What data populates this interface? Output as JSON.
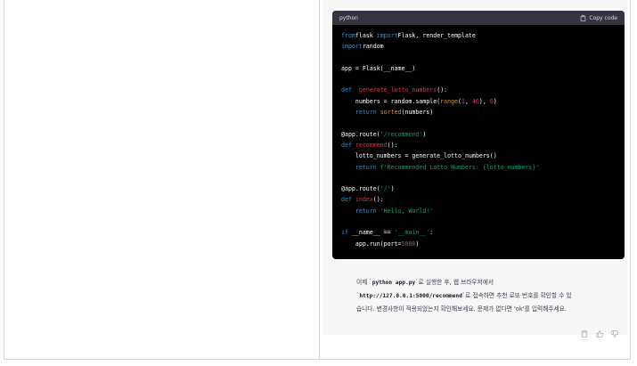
{
  "code_block": {
    "language": "python",
    "copy_label": "Copy code",
    "lines": [
      [
        [
          "kw",
          "from"
        ],
        [
          "",
          "flask "
        ],
        [
          "kw",
          "import"
        ],
        [
          "",
          "Flask, render_template"
        ]
      ],
      [
        [
          "kw",
          "import"
        ],
        [
          "",
          "random"
        ]
      ],
      [],
      [
        [
          "",
          "app = Flask(__name__)"
        ]
      ],
      [],
      [
        [
          "kw",
          "def"
        ],
        [
          "",
          "  "
        ],
        [
          "fn",
          "generate_lotto_numbers"
        ],
        [
          "",
          "():"
        ]
      ],
      [
        [
          "",
          "    numbers = random.sample("
        ],
        [
          "bi",
          "range"
        ],
        [
          "",
          "("
        ],
        [
          "num",
          "1"
        ],
        [
          "",
          ", "
        ],
        [
          "num",
          "46"
        ],
        [
          "",
          "), "
        ],
        [
          "num",
          "6"
        ],
        [
          "",
          ")"
        ]
      ],
      [
        [
          "",
          "    "
        ],
        [
          "kw",
          "return"
        ],
        [
          "",
          ""
        ],
        [
          "bi",
          "sorted"
        ],
        [
          "",
          "(numbers)"
        ]
      ],
      [],
      [
        [
          "",
          "@app.route("
        ],
        [
          "str",
          "'/recommend'"
        ],
        [
          "",
          ")"
        ]
      ],
      [
        [
          "kw",
          "def"
        ],
        [
          "",
          ""
        ],
        [
          "fn",
          "recommend"
        ],
        [
          "",
          "():"
        ]
      ],
      [
        [
          "",
          "    lotto_numbers = generate_lotto_numbers()"
        ]
      ],
      [
        [
          "",
          "    "
        ],
        [
          "kw",
          "return"
        ],
        [
          "",
          ""
        ],
        [
          "str",
          "f'Recommended Lotto Numbers: {lotto_numbers}'"
        ]
      ],
      [],
      [
        [
          "",
          "@app.route("
        ],
        [
          "str",
          "'/'"
        ],
        [
          "",
          ")"
        ]
      ],
      [
        [
          "kw",
          "def"
        ],
        [
          "",
          ""
        ],
        [
          "fn",
          "index"
        ],
        [
          "",
          "():"
        ]
      ],
      [
        [
          "",
          "    "
        ],
        [
          "kw",
          "return"
        ],
        [
          "",
          ""
        ],
        [
          "str",
          "'Hello, World!'"
        ]
      ],
      [],
      [
        [
          "kw",
          "if"
        ],
        [
          "",
          " __name__ == "
        ],
        [
          "str",
          "'__main__'"
        ],
        [
          "",
          ":"
        ]
      ],
      [
        [
          "",
          "    app.run(port="
        ],
        [
          "num",
          "5000"
        ],
        [
          "",
          ")"
        ]
      ]
    ]
  },
  "message": {
    "line1_prefix": "이제 `",
    "line1_code": "python app.py",
    "line1_suffix": "`로 실행한 후, 웹 브라우저에서",
    "line2_prefix": "`",
    "line2_code": "http://127.0.0.1:5000/recommend",
    "line2_suffix": "`로 접속하면 추천 로또 번호를 확인할 수 있",
    "line3": "습니다. 변경사항이 적용되었는지 확인해보세요. 문제가 없다면 'ok'를 입력해주세요."
  },
  "actions": {
    "icons": [
      "clipboard-icon",
      "thumbs-up-icon",
      "thumbs-down-icon"
    ]
  }
}
